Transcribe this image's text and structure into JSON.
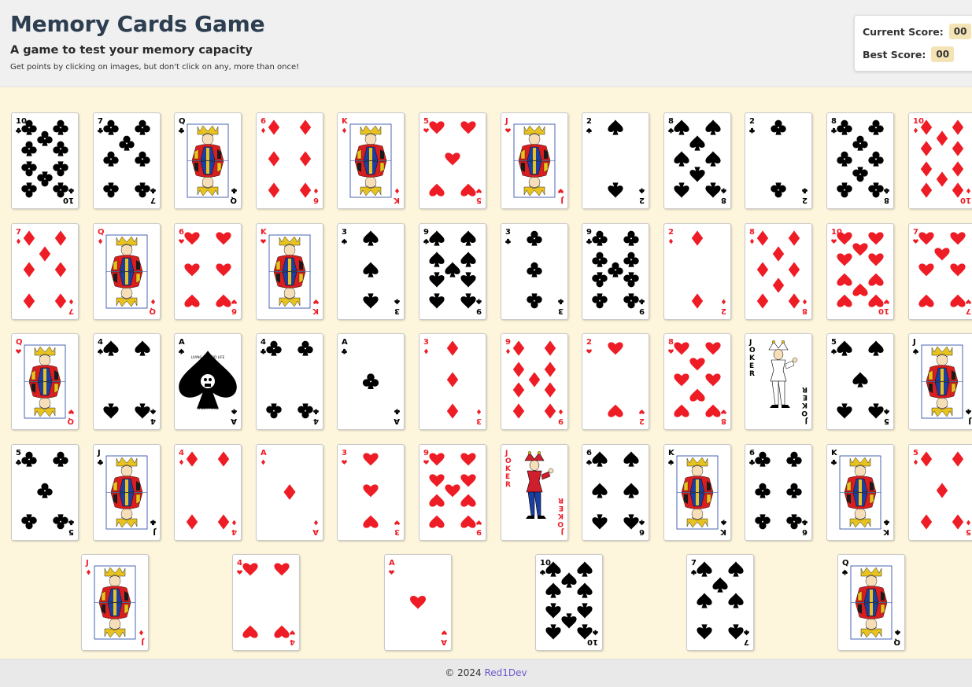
{
  "header": {
    "title": "Memory Cards Game",
    "subtitle": "A game to test your memory capacity",
    "instructions": "Get points by clicking on images, but don't click on any, more than once!"
  },
  "scoreboard": {
    "current_label": "Current Score:",
    "current_value": "00",
    "best_label": "Best Score:",
    "best_value": "00"
  },
  "colors": {
    "red_suit": "#ee1c25",
    "black_suit": "#000000",
    "board": "#fdf6dc",
    "score_badge": "#f4e3b5"
  },
  "cards": [
    {
      "rank": "10",
      "suit": "clubs"
    },
    {
      "rank": "7",
      "suit": "clubs"
    },
    {
      "rank": "Q",
      "suit": "clubs"
    },
    {
      "rank": "6",
      "suit": "diamonds"
    },
    {
      "rank": "K",
      "suit": "diamonds"
    },
    {
      "rank": "5",
      "suit": "hearts"
    },
    {
      "rank": "J",
      "suit": "hearts"
    },
    {
      "rank": "2",
      "suit": "spades"
    },
    {
      "rank": "8",
      "suit": "spades"
    },
    {
      "rank": "2",
      "suit": "clubs"
    },
    {
      "rank": "8",
      "suit": "clubs"
    },
    {
      "rank": "10",
      "suit": "diamonds"
    },
    {
      "rank": "7",
      "suit": "diamonds"
    },
    {
      "rank": "Q",
      "suit": "diamonds"
    },
    {
      "rank": "6",
      "suit": "hearts"
    },
    {
      "rank": "K",
      "suit": "hearts"
    },
    {
      "rank": "3",
      "suit": "spades"
    },
    {
      "rank": "9",
      "suit": "spades"
    },
    {
      "rank": "3",
      "suit": "clubs"
    },
    {
      "rank": "9",
      "suit": "clubs"
    },
    {
      "rank": "2",
      "suit": "diamonds"
    },
    {
      "rank": "8",
      "suit": "diamonds"
    },
    {
      "rank": "10",
      "suit": "hearts"
    },
    {
      "rank": "7",
      "suit": "hearts"
    },
    {
      "rank": "Q",
      "suit": "hearts"
    },
    {
      "rank": "4",
      "suit": "spades"
    },
    {
      "rank": "A",
      "suit": "spades",
      "special_text": [
        "LIVING A GOOD LIFE",
        "IS DUTY PAID"
      ]
    },
    {
      "rank": "4",
      "suit": "clubs"
    },
    {
      "rank": "A",
      "suit": "clubs"
    },
    {
      "rank": "3",
      "suit": "diamonds"
    },
    {
      "rank": "9",
      "suit": "diamonds"
    },
    {
      "rank": "2",
      "suit": "hearts"
    },
    {
      "rank": "8",
      "suit": "hearts"
    },
    {
      "rank": "JOKER",
      "suit": "joker-black"
    },
    {
      "rank": "5",
      "suit": "spades"
    },
    {
      "rank": "J",
      "suit": "spades"
    },
    {
      "rank": "5",
      "suit": "clubs"
    },
    {
      "rank": "J",
      "suit": "clubs"
    },
    {
      "rank": "4",
      "suit": "diamonds"
    },
    {
      "rank": "A",
      "suit": "diamonds"
    },
    {
      "rank": "3",
      "suit": "hearts"
    },
    {
      "rank": "9",
      "suit": "hearts"
    },
    {
      "rank": "JOKER",
      "suit": "joker-red"
    },
    {
      "rank": "6",
      "suit": "spades"
    },
    {
      "rank": "K",
      "suit": "spades"
    },
    {
      "rank": "6",
      "suit": "clubs"
    },
    {
      "rank": "K",
      "suit": "clubs"
    },
    {
      "rank": "5",
      "suit": "diamonds"
    },
    {
      "rank": "J",
      "suit": "diamonds"
    },
    {
      "rank": "4",
      "suit": "hearts"
    },
    {
      "rank": "A",
      "suit": "hearts"
    },
    {
      "rank": "10",
      "suit": "spades"
    },
    {
      "rank": "7",
      "suit": "spades"
    },
    {
      "rank": "Q",
      "suit": "spades"
    }
  ],
  "footer": {
    "copyright": "© 2024 ",
    "author_link": "Red1Dev"
  }
}
